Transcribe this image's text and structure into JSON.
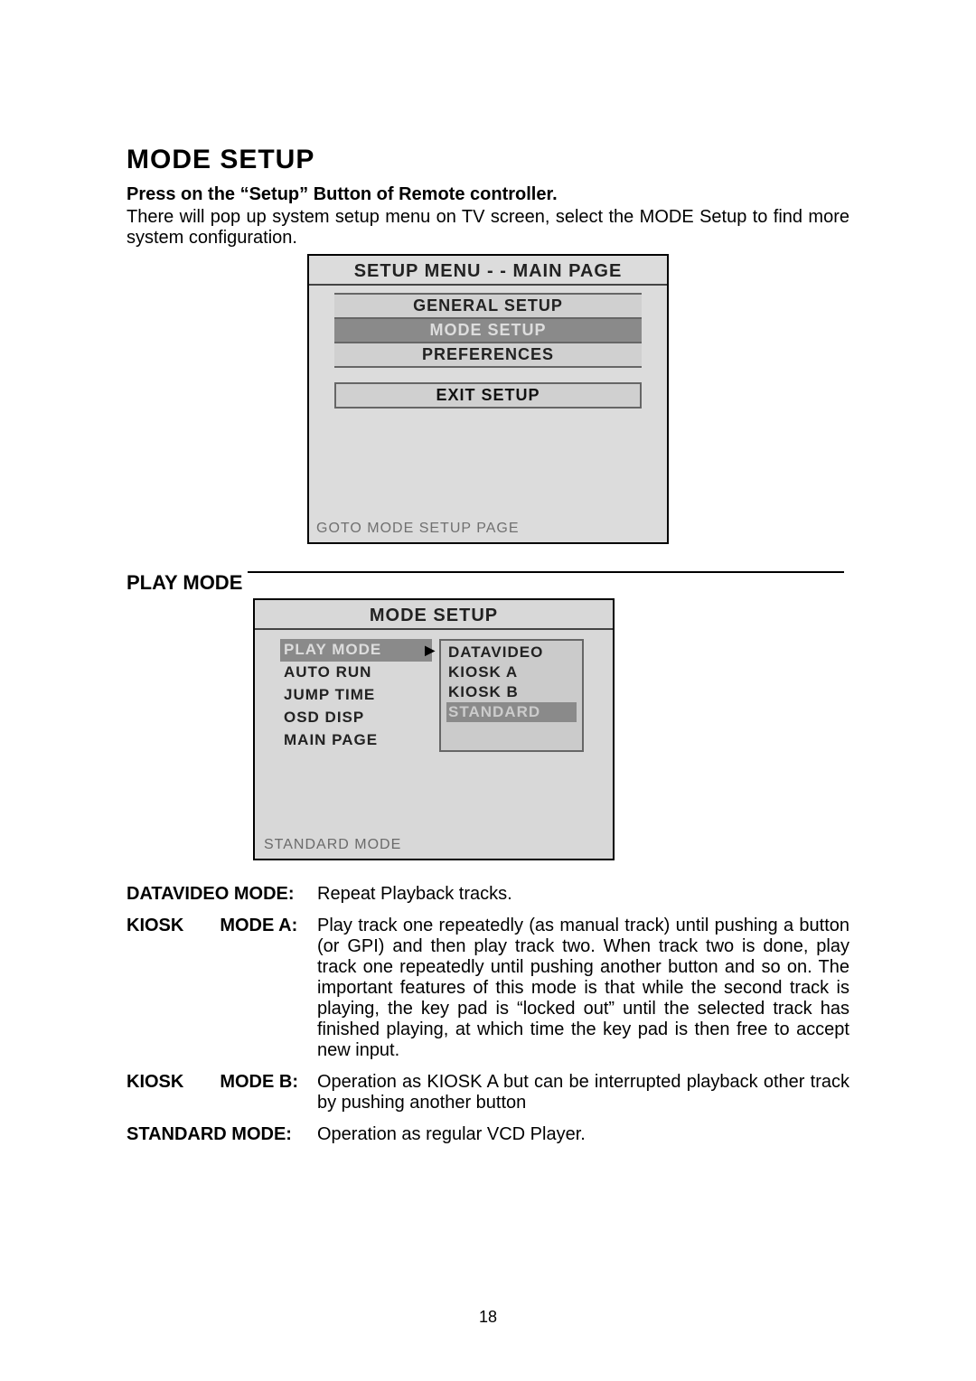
{
  "heading": "MODE   SETUP",
  "press_line": "Press on the “Setup” Button of Remote controller.",
  "intro_line": "There will pop up system setup menu on TV screen, select the MODE Setup to find more system configuration.",
  "osd1": {
    "title": "SETUP MENU   - -   MAIN PAGE",
    "items": [
      "GENERAL SETUP",
      "MODE SETUP",
      "PREFERENCES"
    ],
    "highlight_index": 1,
    "exit": "EXIT SETUP",
    "footnote": "GOTO MODE SETUP PAGE"
  },
  "playmode_label": "PLAY MODE",
  "osd2": {
    "title": "MODE SETUP",
    "left": [
      "PLAY MODE",
      "AUTO RUN",
      "JUMP TIME",
      "OSD DISP",
      "MAIN PAGE"
    ],
    "left_highlight": 0,
    "right": [
      "DATAVIDEO",
      "KIOSK A",
      "KIOSK B",
      "STANDARD"
    ],
    "right_highlight": 3,
    "footnote": "STANDARD MODE"
  },
  "defs": [
    {
      "label": "DATAVIDEO MODE:",
      "desc": "Repeat Playback tracks."
    },
    {
      "label": "KIOSK  MODE A:",
      "desc": "Play track one repeatedly (as manual track) until pushing a button (or GPI) and then play track two. When track two is done, play track one repeatedly until pushing another button and so on. The important features of this mode is that while the second track is playing, the key pad is “locked out” until the selected track has finished playing, at which time the key pad is then free to accept new input."
    },
    {
      "label": "KIOSK  MODE B:",
      "desc": "Operation as KIOSK A but can be interrupted playback other track by pushing another button"
    },
    {
      "label": "STANDARD MODE:",
      "desc": "Operation as regular VCD Player."
    }
  ],
  "page_number": "18"
}
